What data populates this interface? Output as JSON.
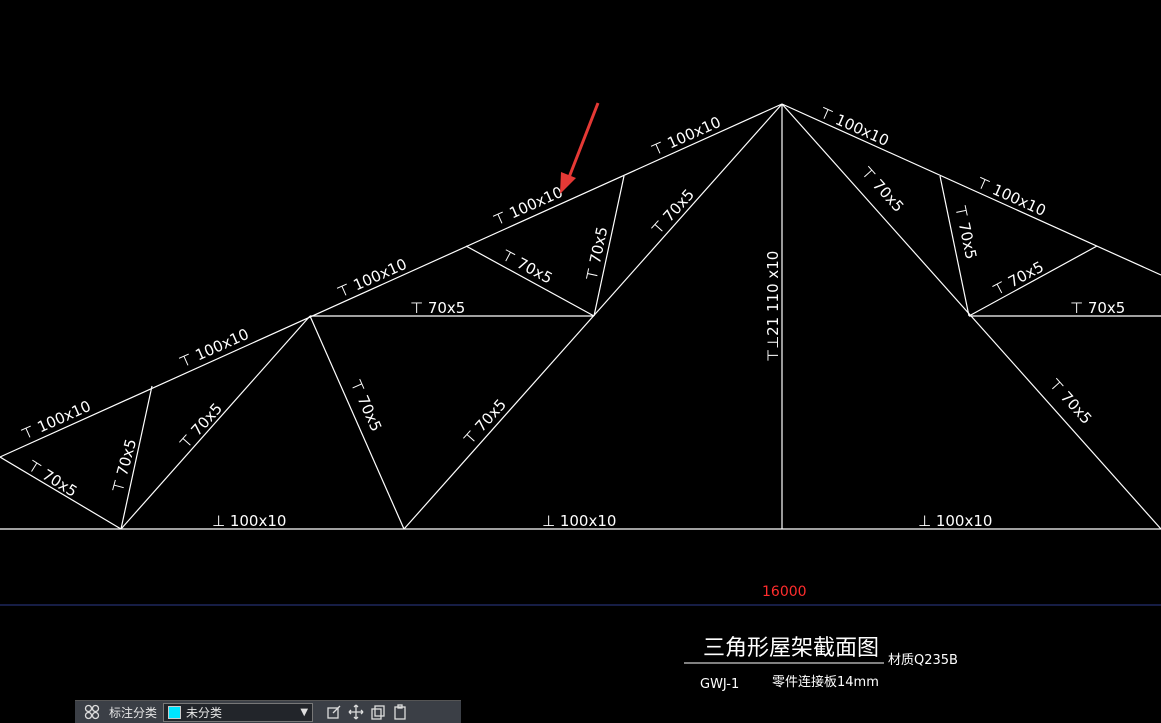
{
  "drawing": {
    "member_labels": {
      "top_chord": "⊤ 100x10",
      "web": "⊤ 70x5",
      "bottom_chord": "⊥ 100x10",
      "king_post": "⊤⊥21 110 x10"
    },
    "span_dimension": "16000",
    "title_block": {
      "title": "三角形屋架截面图",
      "material": "材质Q235B",
      "code": "GWJ-1",
      "plate_note": "零件连接板14mm"
    },
    "colors": {
      "background": "#000000",
      "lines": "#ffffff",
      "dimension": "#ff2d2d",
      "dimension_line": "#2b3a8a",
      "pointer": "#e53935"
    }
  },
  "toolbar": {
    "label": "标注分类",
    "select_value": "未分类",
    "swatch_color": "#00e5ff",
    "icons": [
      "grid-icon",
      "edit-icon",
      "move-icon",
      "copy-icon",
      "paste-icon"
    ]
  }
}
